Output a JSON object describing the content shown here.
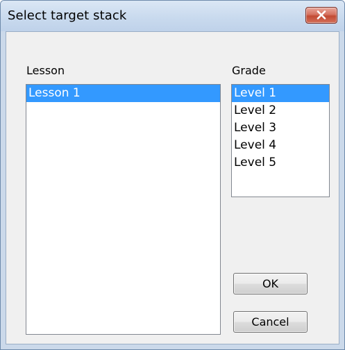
{
  "window": {
    "title": "Select target stack"
  },
  "lesson": {
    "label": "Lesson",
    "items": [
      "Lesson 1"
    ],
    "selected_index": 0
  },
  "grade": {
    "label": "Grade",
    "items": [
      "Level 1",
      "Level 2",
      "Level 3",
      "Level 4",
      "Level 5"
    ],
    "selected_index": 0
  },
  "buttons": {
    "ok_label": "OK",
    "cancel_label": "Cancel"
  },
  "colors": {
    "selection": "#3399ff",
    "close_button": "#c24a33",
    "frame": "#cbd9ea"
  },
  "icons": {
    "close": "close-icon"
  }
}
